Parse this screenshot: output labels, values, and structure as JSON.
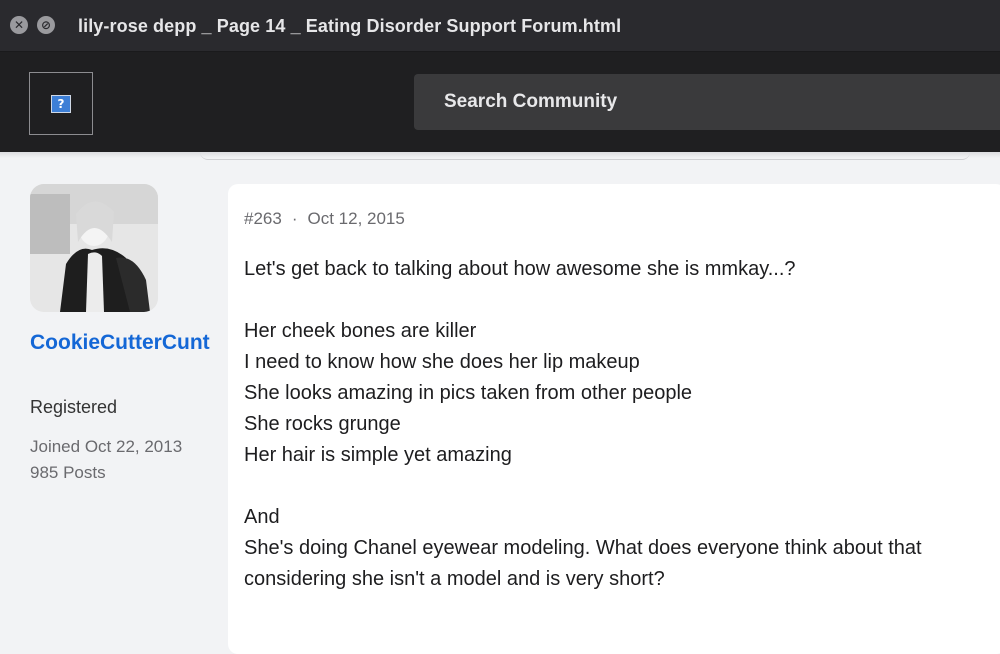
{
  "window": {
    "title": "lily-rose depp _ Page 14 _ Eating Disorder Support Forum.html",
    "close_glyph": "✕",
    "min_glyph": "⊘"
  },
  "header": {
    "logo_glyph": "?",
    "search_placeholder": "Search Community"
  },
  "author": {
    "username": "CookieCutterCunt",
    "role": "Registered",
    "joined": "Joined Oct 22, 2013",
    "posts": "985 Posts"
  },
  "post": {
    "number": "#263",
    "separator": "·",
    "date": "Oct 12, 2015",
    "paragraphs": [
      [
        "Let's get back to talking about how awesome she is mmkay...?"
      ],
      [
        "Her cheek bones are killer",
        "I need to know how she does her lip makeup",
        "She looks amazing in pics taken from other people",
        "She rocks grunge",
        "Her hair is simple yet amazing"
      ],
      [
        "And",
        "She's doing Chanel eyewear modeling. What does everyone think about that considering she isn't a model and is very short?"
      ]
    ]
  }
}
